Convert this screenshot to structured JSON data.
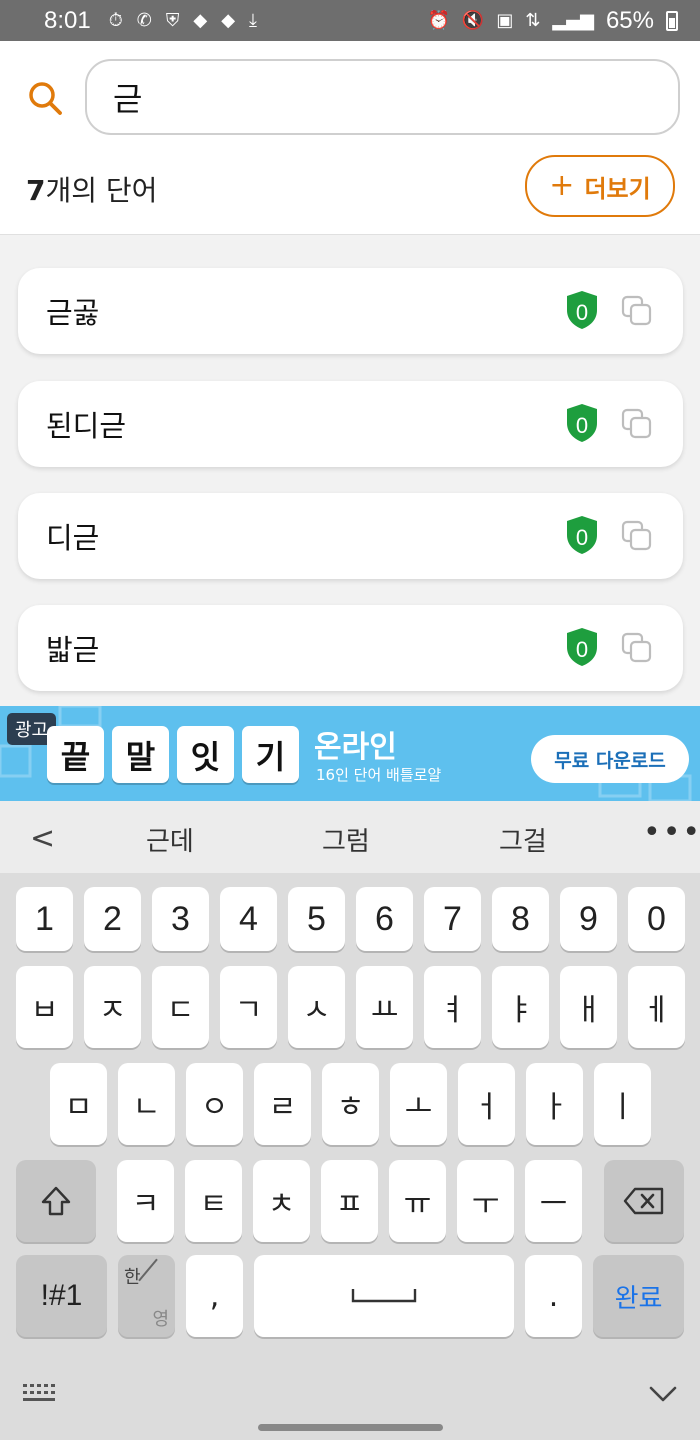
{
  "status": {
    "time": "8:01",
    "battery": "65%"
  },
  "search": {
    "value": "귿"
  },
  "results": {
    "count_number": "7",
    "count_suffix": "개의 단어",
    "more_label": "더보기",
    "more_plus": "+"
  },
  "words": [
    {
      "text": "귿곯",
      "badge": "0"
    },
    {
      "text": "된디귿",
      "badge": "0"
    },
    {
      "text": "디귿",
      "badge": "0"
    },
    {
      "text": "밟귿",
      "badge": "0"
    }
  ],
  "ad": {
    "tag": "광고",
    "tiles": [
      "끝",
      "말",
      "잇",
      "기"
    ],
    "title": "온라인",
    "subtitle": "16인 단어 배틀로얄",
    "button": "무료 다운로드"
  },
  "suggestions": {
    "back": "<",
    "items": [
      "근데",
      "그럼",
      "그걸"
    ],
    "more": "•••"
  },
  "keyboard": {
    "row1": [
      "1",
      "2",
      "3",
      "4",
      "5",
      "6",
      "7",
      "8",
      "9",
      "0"
    ],
    "row2": [
      "ㅂ",
      "ㅈ",
      "ㄷ",
      "ㄱ",
      "ㅅ",
      "ㅛ",
      "ㅕ",
      "ㅑ",
      "ㅐ",
      "ㅔ"
    ],
    "row3": [
      "ㅁ",
      "ㄴ",
      "ㅇ",
      "ㄹ",
      "ㅎ",
      "ㅗ",
      "ㅓ",
      "ㅏ",
      "ㅣ"
    ],
    "row4": [
      "ㅋ",
      "ㅌ",
      "ㅊ",
      "ㅍ",
      "ㅠ",
      "ㅜ",
      "ㅡ"
    ],
    "symbols": "!#1",
    "han": "한",
    "yeong": "영",
    "comma": ",",
    "period": ".",
    "done": "완료"
  },
  "colors": {
    "accent": "#e07a0b",
    "shield_green": "#1e9e3e",
    "ad_blue": "#5ec0ee",
    "done_blue": "#1a73e8"
  }
}
